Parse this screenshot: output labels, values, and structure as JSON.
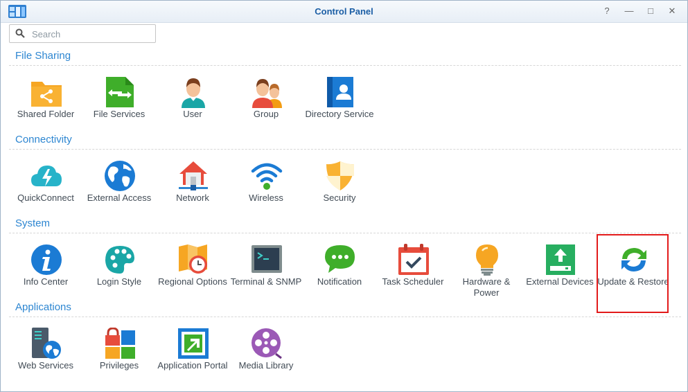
{
  "window": {
    "title": "Control Panel",
    "controls": {
      "help": "?",
      "minimize": "—",
      "maximize": "□",
      "close": "✕"
    }
  },
  "search": {
    "placeholder": "Search",
    "value": ""
  },
  "sections": [
    {
      "title": "File Sharing",
      "items": [
        {
          "label": "Shared Folder",
          "icon": "shared-folder-icon"
        },
        {
          "label": "File Services",
          "icon": "file-services-icon"
        },
        {
          "label": "User",
          "icon": "user-icon"
        },
        {
          "label": "Group",
          "icon": "group-icon"
        },
        {
          "label": "Directory Service",
          "icon": "directory-service-icon"
        }
      ]
    },
    {
      "title": "Connectivity",
      "items": [
        {
          "label": "QuickConnect",
          "icon": "quickconnect-icon"
        },
        {
          "label": "External Access",
          "icon": "globe-icon"
        },
        {
          "label": "Network",
          "icon": "network-house-icon"
        },
        {
          "label": "Wireless",
          "icon": "wifi-icon"
        },
        {
          "label": "Security",
          "icon": "shield-icon"
        }
      ]
    },
    {
      "title": "System",
      "items": [
        {
          "label": "Info Center",
          "icon": "info-icon"
        },
        {
          "label": "Login Style",
          "icon": "palette-icon"
        },
        {
          "label": "Regional Options",
          "icon": "map-clock-icon"
        },
        {
          "label": "Terminal & SNMP",
          "icon": "terminal-icon"
        },
        {
          "label": "Notification",
          "icon": "chat-bubble-icon"
        },
        {
          "label": "Task Scheduler",
          "icon": "calendar-check-icon"
        },
        {
          "label": "Hardware & Power",
          "icon": "lightbulb-icon"
        },
        {
          "label": "External Devices",
          "icon": "external-device-icon"
        },
        {
          "label": "Update & Restore",
          "icon": "refresh-icon"
        }
      ]
    },
    {
      "title": "Applications",
      "items": [
        {
          "label": "Web Services",
          "icon": "web-server-icon"
        },
        {
          "label": "Privileges",
          "icon": "lock-grid-icon"
        },
        {
          "label": "Application Portal",
          "icon": "portal-arrow-icon"
        },
        {
          "label": "Media Library",
          "icon": "film-reel-icon"
        }
      ]
    }
  ],
  "colors": {
    "section_title": "#2d86d1",
    "title_text": "#1b5ea5",
    "highlight": "#e21a1a"
  }
}
